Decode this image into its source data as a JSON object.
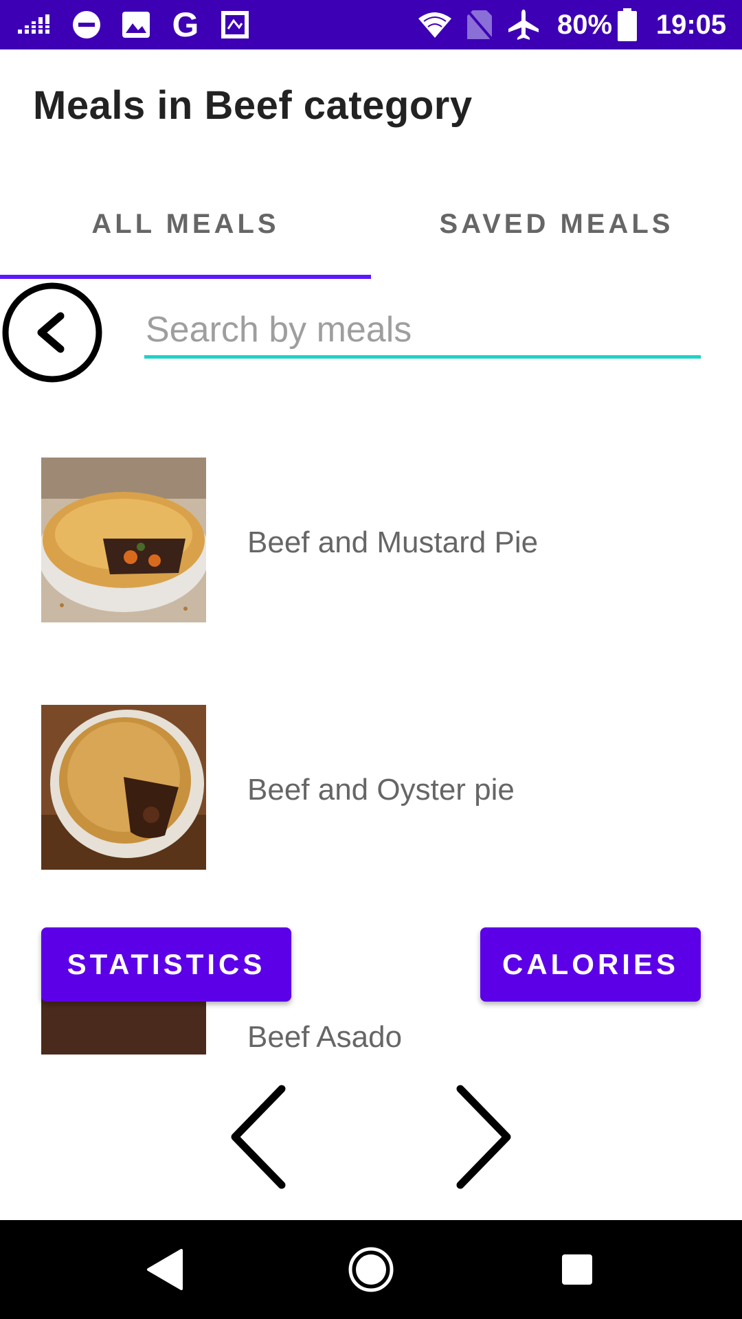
{
  "status_bar": {
    "background": "#3d00b4",
    "left_icons": [
      "signal-bars-icon",
      "do-not-disturb-icon",
      "image-icon",
      "google-icon",
      "stamp-icon"
    ],
    "right_icons": [
      "wifi-icon",
      "no-sim-icon",
      "airplane-mode-icon",
      "battery-icon"
    ],
    "battery": "80%",
    "time": "19:05"
  },
  "header": {
    "title": "Meals in Beef category"
  },
  "tabs": [
    {
      "label": "ALL MEALS",
      "selected": true
    },
    {
      "label": "SAVED MEALS",
      "selected": false
    }
  ],
  "accent_color": "#5c17ff",
  "search": {
    "placeholder": "Search by meals",
    "value": "",
    "underline_color": "#1fd3c6"
  },
  "meals": [
    {
      "name": "Beef and Mustard Pie",
      "image": "pie-with-carrots-image"
    },
    {
      "name": "Beef and Oyster pie",
      "image": "pie-on-board-image"
    },
    {
      "name": "Beef Asado",
      "image": "beef-stew-image"
    }
  ],
  "buttons": {
    "statistics": "STATISTICS",
    "calories": "CALORIES",
    "color": "#5c00e8"
  },
  "icons": {
    "back": "back-circle-icon",
    "prev": "chevron-left-icon",
    "next": "chevron-right-icon"
  },
  "nav_bar": {
    "buttons": [
      "nav-back-icon",
      "nav-home-icon",
      "nav-recents-icon"
    ]
  }
}
